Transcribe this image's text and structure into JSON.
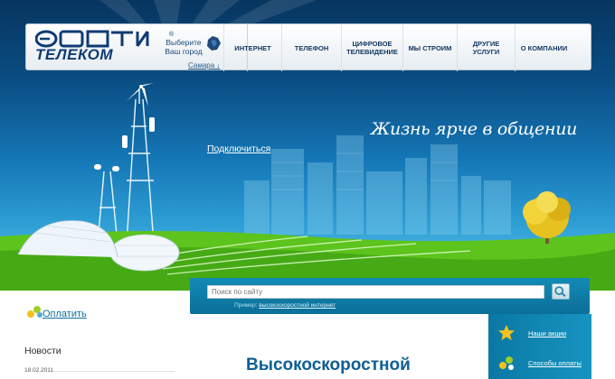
{
  "brand": {
    "name": "ТЕЛЕКОМ",
    "reg_mark": "®"
  },
  "city": {
    "prompt": "Выберите Ваш город",
    "current": "Самара ↓",
    "icon": "region-map-icon"
  },
  "nav": {
    "items": [
      {
        "label": "ИНТЕРНЕТ"
      },
      {
        "label": "ТЕЛЕФОН"
      },
      {
        "label": "ЦИФРОВОЕ ТЕЛЕВИДЕНИЕ"
      },
      {
        "label": "МЫ СТРОИМ"
      },
      {
        "label": "ДРУГИЕ УСЛУГИ"
      },
      {
        "label": "О КОМПАНИИ"
      }
    ]
  },
  "hero": {
    "slogan": "Жизнь ярче в общении",
    "connect_link": "Подключиться"
  },
  "search": {
    "placeholder": "Поиск по сайту",
    "example_prefix": "Пример: ",
    "example_link": "высокоскоростной интернет",
    "button_icon": "search-icon"
  },
  "left": {
    "pay_link": "Оплатить",
    "news_title": "Новости",
    "news_date": "18.02.2011"
  },
  "main": {
    "headline": "Высокоскоростной"
  },
  "sidebar": {
    "items": [
      {
        "label": "Наши акции",
        "icon": "star-icon"
      },
      {
        "label": "Способы оплаты",
        "icon": "coins-icon"
      }
    ]
  },
  "colors": {
    "brand_blue": "#0f3b73",
    "link_blue": "#0e6f9f",
    "panel_teal": "#0b6f99",
    "grass_green": "#5cc41c"
  }
}
